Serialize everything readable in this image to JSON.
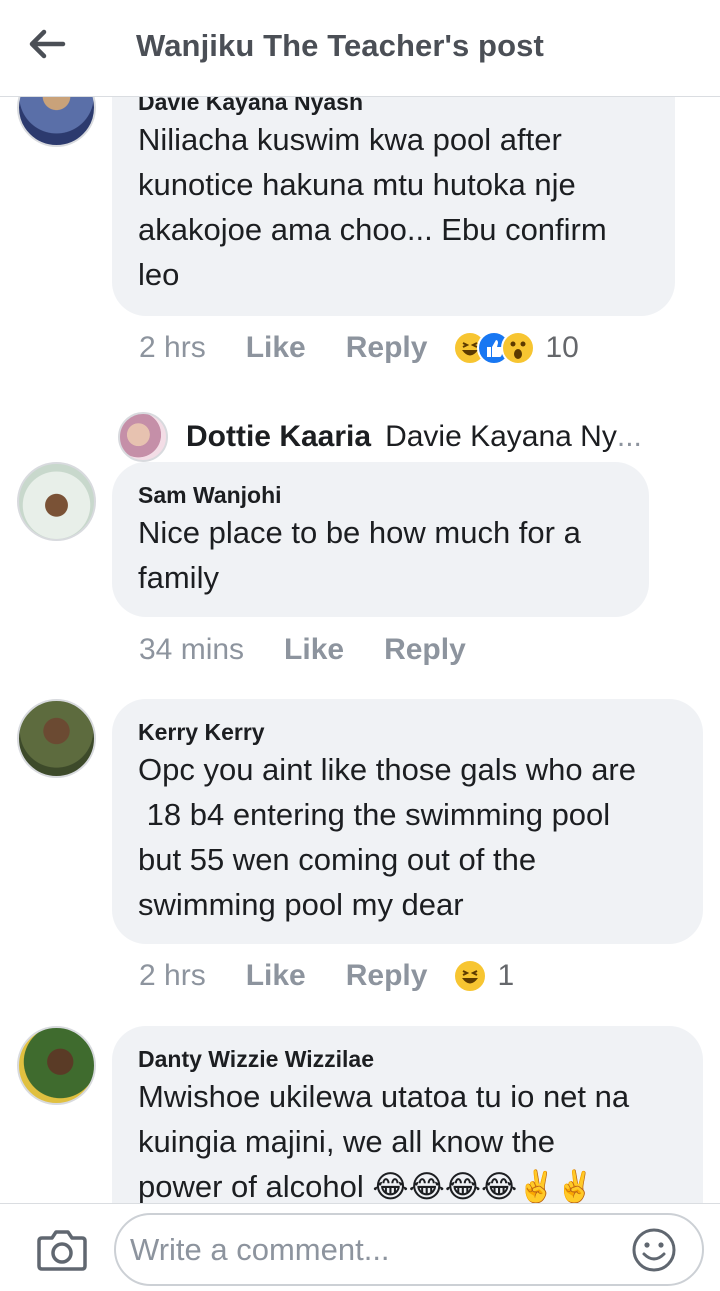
{
  "header": {
    "back_icon": "arrow-left-icon",
    "title": "Wanjiku The Teacher's post"
  },
  "comments": [
    {
      "author": "Davie Kayana Nyash",
      "lines": [
        "Niliacha kuswim kwa pool after",
        "kunotice hakuna mtu hutoka nje",
        "akakojoe ama choo... Ebu confirm",
        "leo"
      ],
      "time": "2 hrs",
      "like_label": "Like",
      "reply_label": "Reply",
      "reactions": [
        "haha",
        "like",
        "wow"
      ],
      "reaction_count": "10",
      "reply": {
        "name": "Dottie Kaaria",
        "text": "Davie Kayana Ny",
        "ellipsis": "..."
      }
    },
    {
      "author": "Sam Wanjohi",
      "lines": [
        "Nice place to be how much for a",
        "family"
      ],
      "time": "34 mins",
      "like_label": "Like",
      "reply_label": "Reply"
    },
    {
      "author": "Kerry Kerry",
      "lines": [
        "Opc you aint like those gals who are",
        " 18 b4 entering the swimming pool",
        "but 55 wen coming out of the",
        "swimming pool my dear"
      ],
      "time": "2 hrs",
      "like_label": "Like",
      "reply_label": "Reply",
      "reactions": [
        "haha"
      ],
      "reaction_count": "1"
    },
    {
      "author": "Danty Wizzie Wizzilae",
      "lines": [
        "Mwishoe ukilewa utatoa tu io net na",
        "kuingia majini, we all know the",
        "power of alcohol 😂😂😂😂✌️✌️"
      ]
    }
  ],
  "composer": {
    "placeholder": "Write a comment...",
    "camera_icon": "camera-icon",
    "emoji_icon": "smiley-icon"
  },
  "colors": {
    "bubble": "#f0f2f5",
    "meta_text": "#8d949e",
    "like_blue": "#1877f2",
    "haha_yellow": "#f7c531"
  }
}
